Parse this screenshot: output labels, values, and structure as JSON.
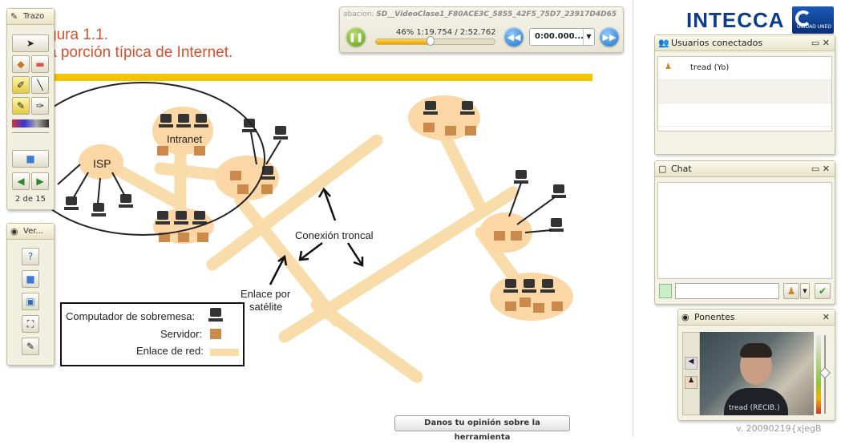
{
  "slide": {
    "title_line1": "gura 1.1.",
    "title_line2": "a porción típica de Internet.",
    "labels": {
      "isp": "ISP",
      "intranet": "Intranet",
      "backbone": "Conexión troncal",
      "satellite_1": "Enlace por",
      "satellite_2": "satélite"
    },
    "legend": {
      "desktop": "Computador de sobremesa:",
      "server": "Servidor:",
      "link": "Enlace de red:"
    }
  },
  "playback": {
    "recording_prefix": "abacion:",
    "recording_name": "SD__VideoClase1_F80ACE3C_5855_42F5_75D7_23917D4D65",
    "progress_percent": 46,
    "progress_text": "46%  1:19.754 / 2:52.762",
    "time_value": "0:00.000...",
    "pause_icon": "pause-icon",
    "rewind_icon": "rewind-icon",
    "forward_icon": "fast-forward-icon"
  },
  "tools_palette": {
    "title": "Trazo",
    "page_count": "2 de 15"
  },
  "view_palette": {
    "title": "Ver..."
  },
  "brand": {
    "name": "INTECCA",
    "badge_text": "UNIDAD UNED"
  },
  "users_panel": {
    "title": "Usuarios conectados",
    "users": [
      "tread (Yo)"
    ]
  },
  "chat_panel": {
    "title": "Chat",
    "input_value": ""
  },
  "speakers_panel": {
    "title": "Ponentes",
    "video_label": "tread (RECIB.)"
  },
  "feedback_label": "Danos tu opinión sobre la herramienta",
  "version": "v. 20090219{xjegB",
  "colors": {
    "cloud": "#fcd7a6",
    "server": "#c98a4b",
    "link": "#f8dca9",
    "title": "#d94f2b",
    "accent_bar": "#f5c400"
  }
}
